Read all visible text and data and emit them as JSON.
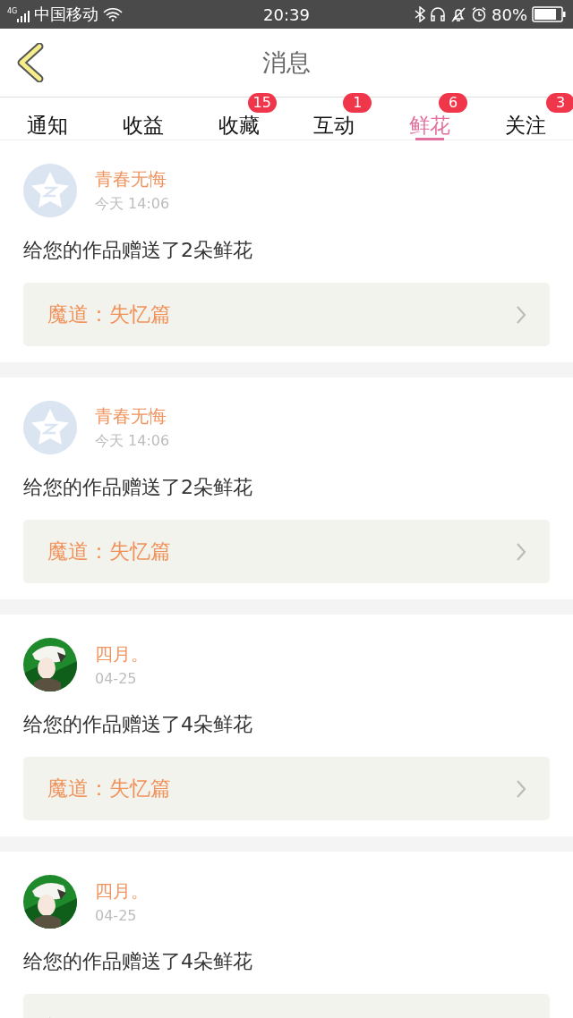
{
  "status_bar": {
    "network": "4G",
    "carrier": "中国移动",
    "time": "20:39",
    "battery": "80%"
  },
  "header": {
    "title": "消息"
  },
  "tabs": [
    {
      "label": "通知",
      "selected": false
    },
    {
      "label": "收益",
      "selected": false
    },
    {
      "label": "收藏",
      "selected": false,
      "badge": "15"
    },
    {
      "label": "互动",
      "selected": false,
      "badge": "1"
    },
    {
      "label": "鲜花",
      "selected": true,
      "badge": "6"
    },
    {
      "label": "关注",
      "selected": false,
      "badge": "3"
    }
  ],
  "messages": [
    {
      "avatar": {
        "kind": "default"
      },
      "name": "青春无悔",
      "time": "今天 14:06",
      "text": "给您的作品赠送了2朵鲜花",
      "work": "魔道：失忆篇"
    },
    {
      "avatar": {
        "kind": "default"
      },
      "name": "青春无悔",
      "time": "今天 14:06",
      "text": "给您的作品赠送了2朵鲜花",
      "work": "魔道：失忆篇"
    },
    {
      "name": "四月。",
      "time": "04-25",
      "text": "给您的作品赠送了4朵鲜花",
      "work": "魔道：失忆篇"
    },
    {
      "name": "四月。",
      "time": "04-25",
      "text": "给您的作品赠送了4朵鲜花"
    }
  ]
}
